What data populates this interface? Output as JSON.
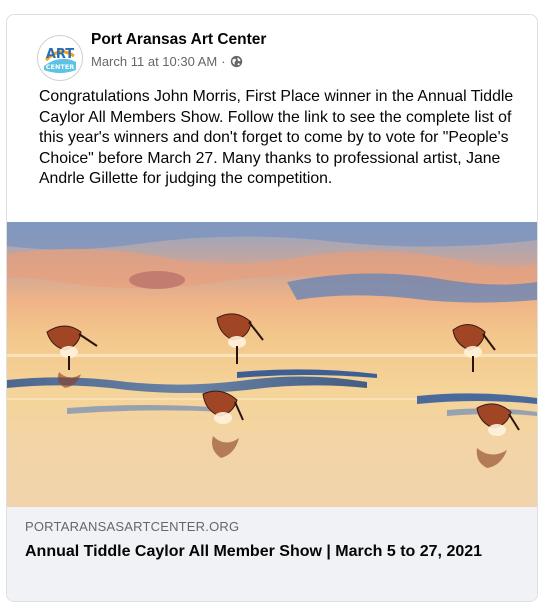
{
  "post": {
    "page_name": "Port Aransas Art Center",
    "timestamp": "March 11 at 10:30 AM",
    "separator": "·",
    "privacy_icon": "globe-icon",
    "avatar_logo": "ART CENTER",
    "text": "Congratulations John Morris, First Place winner in the Annual Tiddle Caylor All Members Show. Follow the link to see the complete list of this year's winners and don't forget to come by to vote for \"People's Choice\" before March 27. Many thanks to professional artist, Jane Andrle Gillette for judging the competition.",
    "image_subject": "painting of shorebirds feeding on a reflective beach at sunset"
  },
  "link_preview": {
    "domain": "PORTARANSASARTCENTER.ORG",
    "title": "Annual Tiddle Caylor All Member Show | March 5 to 27, 2021"
  },
  "colors": {
    "text_primary": "#050505",
    "text_secondary": "#65676b",
    "link_bg": "#f0f2f5",
    "border": "#dddfe2"
  }
}
